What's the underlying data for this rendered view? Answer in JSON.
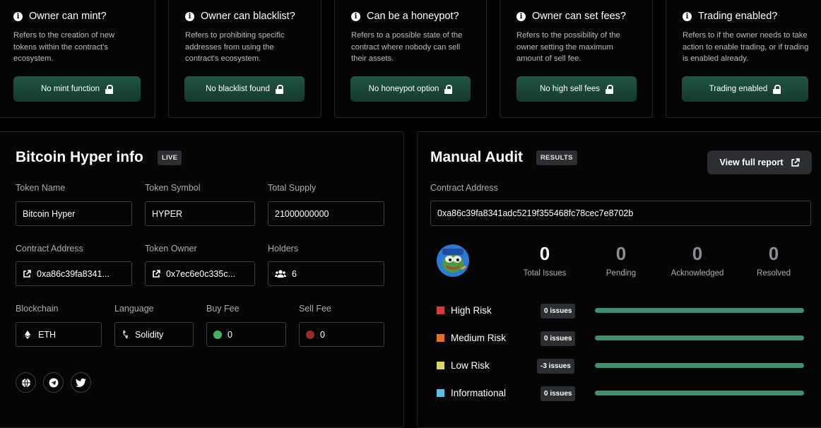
{
  "cards": [
    {
      "title": "Owner can mint?",
      "desc": "Refers to the creation of new tokens within the contract's ecosystem.",
      "button": "No mint function"
    },
    {
      "title": "Owner can blacklist?",
      "desc": "Refers to prohibiting specific addresses from using the contract's ecosystem.",
      "button": "No blacklist found"
    },
    {
      "title": "Can be a honeypot?",
      "desc": "Refers to a possible state of the contract where nobody can sell their assets.",
      "button": "No honeypot option"
    },
    {
      "title": "Owner can set fees?",
      "desc": "Refers to the possibility of the owner setting the maximum amount of sell fee.",
      "button": "No high sell fees"
    },
    {
      "title": "Trading enabled?",
      "desc": "Refers to if the owner needs to take action to enable trading, or if trading is enabled already.",
      "button": "Trading enabled"
    }
  ],
  "info": {
    "title": "Bitcoin Hyper info",
    "badge": "LIVE",
    "token_name_label": "Token Name",
    "token_name": "Bitcoin Hyper",
    "token_symbol_label": "Token Symbol",
    "token_symbol": "HYPER",
    "total_supply_label": "Total Supply",
    "total_supply": "21000000000",
    "contract_label": "Contract Address",
    "contract": "0xa86c39fa8341...",
    "owner_label": "Token Owner",
    "owner": "0x7ec6e0c335c...",
    "holders_label": "Holders",
    "holders": "6",
    "chain_label": "Blockchain",
    "chain": "ETH",
    "language_label": "Language",
    "language": "Solidity",
    "buy_fee_label": "Buy Fee",
    "buy_fee": "0",
    "sell_fee_label": "Sell Fee",
    "sell_fee": "0"
  },
  "audit": {
    "title": "Manual Audit",
    "badge": "RESULTS",
    "view_report": "View full report",
    "contract_label": "Contract Address",
    "contract": "0xa86c39fa8341adc5219f355468fc78cec7e8702b",
    "stats": [
      {
        "value": "0",
        "label": "Total Issues"
      },
      {
        "value": "0",
        "label": "Pending"
      },
      {
        "value": "0",
        "label": "Acknowledged"
      },
      {
        "value": "0",
        "label": "Resolved"
      }
    ],
    "risks": [
      {
        "label": "High Risk",
        "issues": "0 issues",
        "color": "#d23c3c"
      },
      {
        "label": "Medium Risk",
        "issues": "0 issues",
        "color": "#e8701e"
      },
      {
        "label": "Low Risk",
        "issues": "-3 issues",
        "color": "#d9d56a"
      },
      {
        "label": "Informational",
        "issues": "0 issues",
        "color": "#5bc1e0"
      }
    ],
    "bar_color": "#3e8e6f"
  }
}
